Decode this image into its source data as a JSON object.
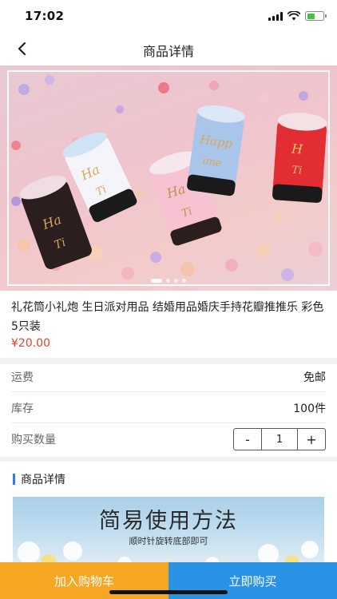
{
  "status_bar": {
    "time": "17:02",
    "battery_level": 0.5
  },
  "nav": {
    "title": "商品详情",
    "back_icon": "chevron-left-icon"
  },
  "banner": {
    "slide_count": 4,
    "active_slide": 1
  },
  "product": {
    "title": "礼花筒小礼炮 生日派对用品 结婚用品婚庆手持花瓣推推乐 彩色5只装",
    "price": "¥20.00"
  },
  "rows": {
    "shipping": {
      "label": "运费",
      "value": "免邮"
    },
    "stock": {
      "label": "库存",
      "value": "100件"
    },
    "quantity": {
      "label": "购买数量",
      "minus": "-",
      "value": "1",
      "plus": "+"
    }
  },
  "details": {
    "heading": "商品详情",
    "image_title": "简易使用方法",
    "image_subtitle": "顺时针旋转底部即可"
  },
  "bottom": {
    "add_to_cart": "加入购物车",
    "buy_now": "立即购买"
  },
  "colors": {
    "price": "#e63e2f",
    "accent_blue": "#2b93e6",
    "accent_orange": "#f5a623",
    "section_bar": "#2f7fe6"
  }
}
